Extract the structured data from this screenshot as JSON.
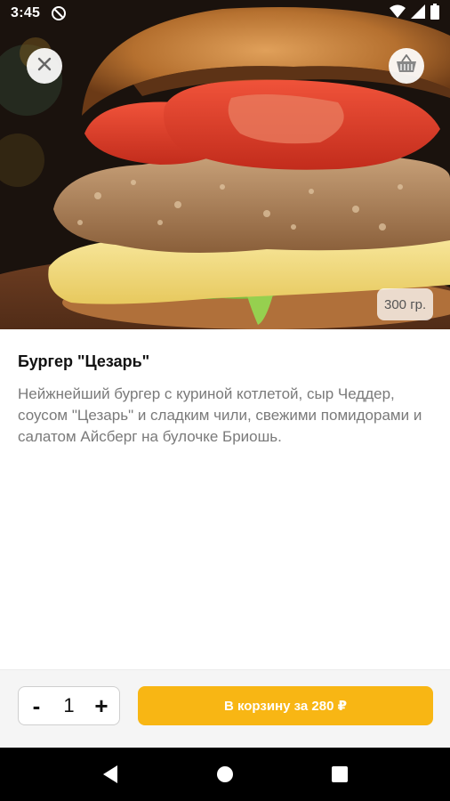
{
  "status_bar": {
    "time": "3:45",
    "left_icon": "do-not-disturb-icon",
    "right_icons": [
      "wifi-icon",
      "signal-icon",
      "battery-icon"
    ]
  },
  "hero": {
    "image": "burger-photo",
    "close_icon": "close-icon",
    "cart_icon": "basket-icon",
    "weight": "300 гр."
  },
  "product": {
    "title": "Бургер \"Цезарь\"",
    "description": "Нейжнейший бургер с куриной котлетой, сыр Чеддер, соусом \"Цезарь\" и сладким чили, свежими помидорами и салатом Айсберг на булочке Бриошь."
  },
  "order": {
    "minus": "-",
    "quantity": "1",
    "plus": "+",
    "add_to_cart": "В корзину за 280 ₽"
  },
  "nav_bar": {
    "icons": [
      "back-icon",
      "home-icon",
      "recents-icon"
    ]
  },
  "colors": {
    "accent": "#f8b614",
    "description_text": "#7a7a7a"
  }
}
